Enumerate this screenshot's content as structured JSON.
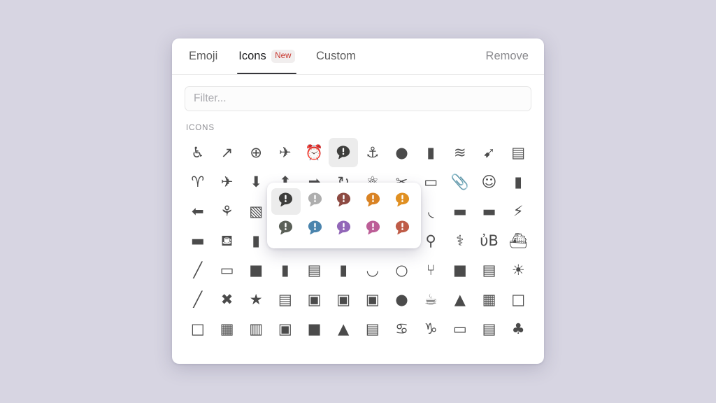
{
  "background_color": "#d7d5e2",
  "panel": {
    "tabs": [
      {
        "label": "Emoji",
        "active": false,
        "badge": null
      },
      {
        "label": "Icons",
        "active": true,
        "badge": "New"
      },
      {
        "label": "Custom",
        "active": false,
        "badge": null
      }
    ],
    "remove_label": "Remove",
    "filter": {
      "value": "",
      "placeholder": "Filter..."
    },
    "section_label": "ICONS",
    "selected_icon_index": 5,
    "icons": [
      {
        "name": "accessibility-icon"
      },
      {
        "name": "chart-trending-up-icon"
      },
      {
        "name": "plus-circle-icon"
      },
      {
        "name": "airplane-icon"
      },
      {
        "name": "alarm-clock-icon"
      },
      {
        "name": "alert-message-icon"
      },
      {
        "name": "anchor-icon"
      },
      {
        "name": "apple-icon"
      },
      {
        "name": "apron-icon"
      },
      {
        "name": "waves-icon"
      },
      {
        "name": "archery-bow-icon"
      },
      {
        "name": "archive-box-icon"
      },
      {
        "name": "aries-zodiac-icon"
      },
      {
        "name": "airplane-landing-icon"
      },
      {
        "name": "arrow-down-circle-icon"
      },
      {
        "name": "arrow-up-circle-icon"
      },
      {
        "name": "arrow-right-circle-icon"
      },
      {
        "name": "arrow-sync-icon"
      },
      {
        "name": "atom-icon"
      },
      {
        "name": "attachment-icon"
      },
      {
        "name": "atm-icon"
      },
      {
        "name": "paperclip-icon"
      },
      {
        "name": "baby-icon"
      },
      {
        "name": "backpack-icon"
      },
      {
        "name": "arrow-left-icon"
      },
      {
        "name": "badminton-icon"
      },
      {
        "name": "baggage-icon"
      },
      {
        "name": "balloon-icon"
      },
      {
        "name": "bandage-icon"
      },
      {
        "name": "bank-icon"
      },
      {
        "name": "barcode-icon"
      },
      {
        "name": "baseball-icon"
      },
      {
        "name": "bathtub-icon"
      },
      {
        "name": "battery-full-icon"
      },
      {
        "name": "battery-charging-icon"
      },
      {
        "name": "battery-bolt-icon"
      },
      {
        "name": "bed-icon"
      },
      {
        "name": "beer-glass-icon"
      },
      {
        "name": "beer-bottle-icon"
      },
      {
        "name": "bell-icon"
      },
      {
        "name": "bell-off-icon"
      },
      {
        "name": "bench-press-icon"
      },
      {
        "name": "bicycle-icon"
      },
      {
        "name": "binoculars-stand-icon"
      },
      {
        "name": "binoculars-icon"
      },
      {
        "name": "blood-pressure-icon"
      },
      {
        "name": "bluetooth-icon"
      },
      {
        "name": "boat-icon"
      },
      {
        "name": "bone-icon"
      },
      {
        "name": "book-open-icon"
      },
      {
        "name": "book-icon"
      },
      {
        "name": "bookmark-icon"
      },
      {
        "name": "boombox-icon"
      },
      {
        "name": "boot-icon"
      },
      {
        "name": "bowl-icon"
      },
      {
        "name": "brain-head-icon"
      },
      {
        "name": "branch-icon"
      },
      {
        "name": "bread-icon"
      },
      {
        "name": "briefcase-icon"
      },
      {
        "name": "brightness-sun-icon"
      },
      {
        "name": "broom-icon"
      },
      {
        "name": "close-circle-icon"
      },
      {
        "name": "bug-icon"
      },
      {
        "name": "bunk-bed-icon"
      },
      {
        "name": "bus-icon"
      },
      {
        "name": "bus-front-icon"
      },
      {
        "name": "bus-double-icon"
      },
      {
        "name": "cable-circle-icon"
      },
      {
        "name": "coffee-cup-icon"
      },
      {
        "name": "cake-icon"
      },
      {
        "name": "calculator-icon"
      },
      {
        "name": "calendar-icon"
      },
      {
        "name": "calendar-day-icon"
      },
      {
        "name": "calendar-month-icon"
      },
      {
        "name": "calendar-week-icon"
      },
      {
        "name": "camera-icon"
      },
      {
        "name": "cards-stack-icon"
      },
      {
        "name": "tent-icon"
      },
      {
        "name": "caravan-icon"
      },
      {
        "name": "cancer-zodiac-icon"
      },
      {
        "name": "capricorn-zodiac-icon"
      },
      {
        "name": "car-icon"
      },
      {
        "name": "id-card-icon"
      },
      {
        "name": "card-clubs-icon"
      }
    ]
  },
  "popover": {
    "icon_name": "alert-message-icon",
    "selected_swatch_index": 0,
    "swatches": [
      {
        "name": "swatch-charcoal",
        "color": "#3e3e3c"
      },
      {
        "name": "swatch-gray",
        "color": "#aeaeae"
      },
      {
        "name": "swatch-maroon",
        "color": "#8d4a42"
      },
      {
        "name": "swatch-orange",
        "color": "#d98324"
      },
      {
        "name": "swatch-amber",
        "color": "#e09022"
      },
      {
        "name": "swatch-slate-green",
        "color": "#5b6058"
      },
      {
        "name": "swatch-blue",
        "color": "#4a84ad"
      },
      {
        "name": "swatch-purple",
        "color": "#9267b8"
      },
      {
        "name": "swatch-magenta",
        "color": "#bc5e97"
      },
      {
        "name": "swatch-rust",
        "color": "#bf5c48"
      }
    ]
  }
}
